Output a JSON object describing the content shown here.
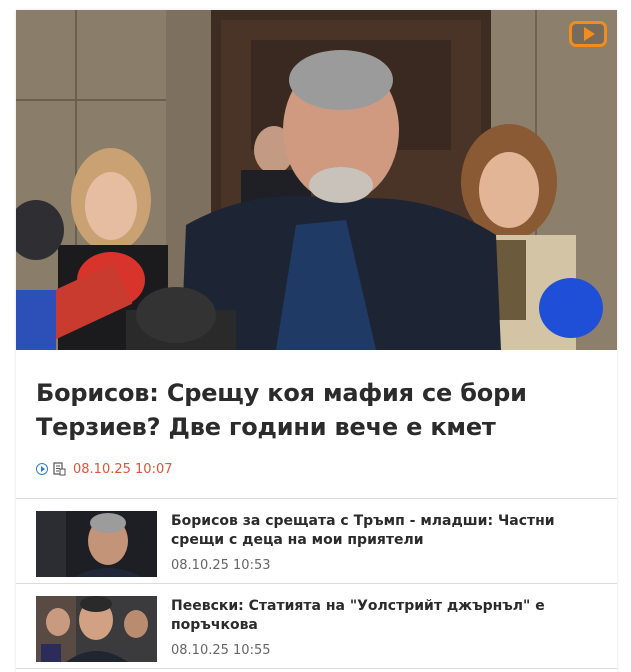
{
  "hero": {
    "image_icon": "photo-politician-press",
    "video_badge_icon": "play-icon"
  },
  "main_article": {
    "title": "Борисов: Срещу коя мафия се бори Терзиев? Две години вече е кмет",
    "icons": [
      "play-circle-icon",
      "document-icon"
    ],
    "time": "08.10.25 10:07",
    "time_color": "#e0533a"
  },
  "related": [
    {
      "title": "Борисов за срещата с Тръмп - младши: Частни срещи с деца на мои приятели",
      "time": "08.10.25 10:53"
    },
    {
      "title": "Пеевски: Статията на \"Уолстрийт джърнъл\" е поръчкова",
      "time": "08.10.25 10:55"
    }
  ],
  "colors": {
    "accent_orange": "#f28c1c",
    "accent_blue": "#2a7fd4"
  }
}
